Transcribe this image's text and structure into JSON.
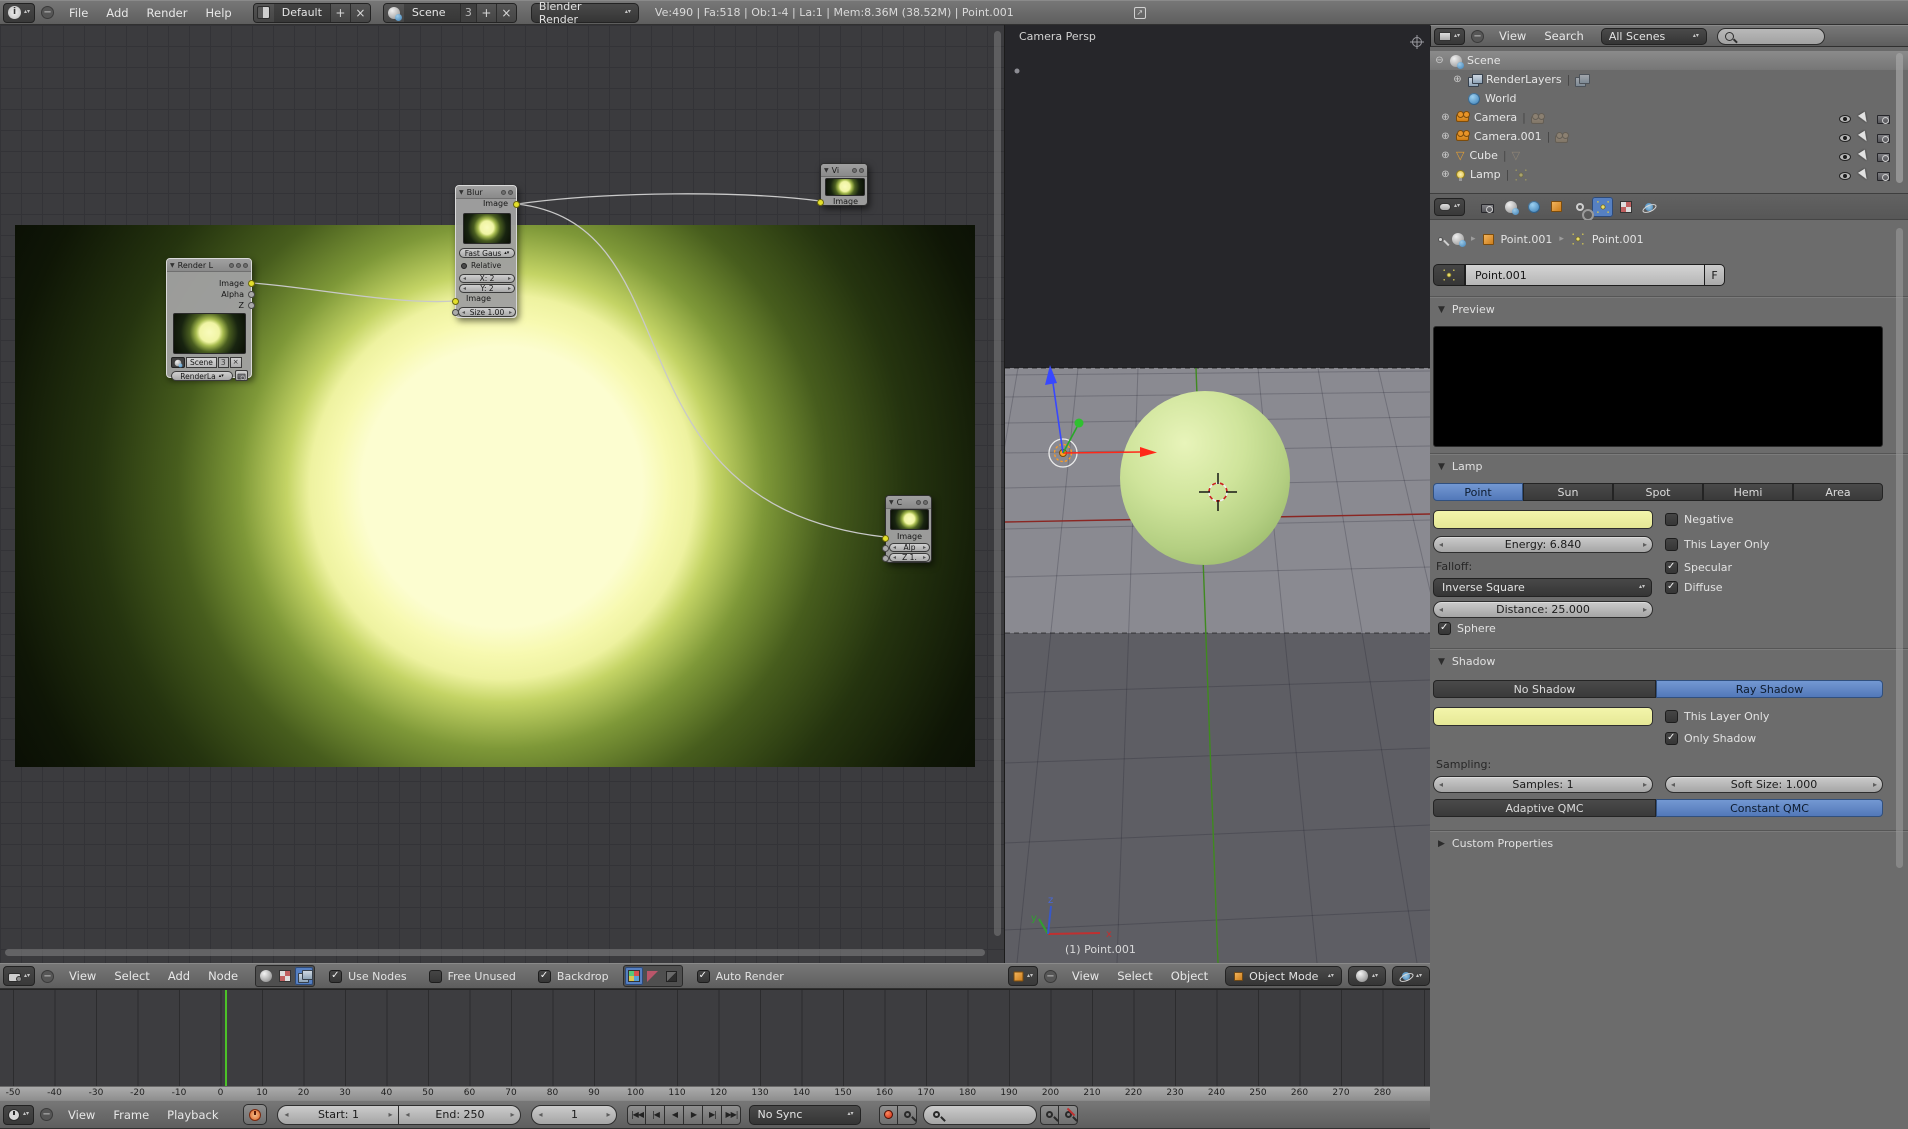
{
  "colors": {
    "accent": "#5680c2",
    "lamp_yellow": "#eef0a0",
    "socket_yellow": "#e3df2b",
    "sphere_green": "#cfe49b",
    "current_frame_green": "#4cc228"
  },
  "top_header": {
    "menus": [
      "File",
      "Add",
      "Render",
      "Help"
    ],
    "layout": "Default",
    "scene": "Scene",
    "scene_users": "3",
    "engine": "Blender Render",
    "stats": "Ve:490 | Fa:518 | Ob:1-4 | La:1 | Mem:8.36M (38.52M) | Point.001"
  },
  "node_editor": {
    "menus": [
      "View",
      "Select",
      "Add",
      "Node"
    ],
    "toggles": {
      "use_nodes": "Use Nodes",
      "free_unused": "Free Unused",
      "backdrop": "Backdrop",
      "auto_render": "Auto Render"
    },
    "nodes": {
      "render_layers": {
        "title": "Render L",
        "outputs": [
          "Image",
          "Alpha",
          "Z"
        ],
        "scene_field": "Scene",
        "scene_users": "3",
        "layer_field": "RenderLa"
      },
      "blur": {
        "title": "Blur",
        "output": "Image",
        "filter_type": "Fast Gaus",
        "relative_label": "Relative",
        "x_field": "X: 2",
        "y_field": "Y: 2",
        "input": "Image",
        "size_field": "Size 1.00"
      },
      "viewer": {
        "title": "Vi",
        "input": "Image"
      },
      "composite": {
        "title": "C",
        "input": "Image",
        "alpha_field": "Alp",
        "z_field": "Z 1."
      }
    }
  },
  "viewport": {
    "view_label": "Camera Persp",
    "object_info": "(1) Point.001",
    "menus": [
      "View",
      "Select",
      "Object"
    ],
    "mode": "Object Mode",
    "axis": {
      "x": "x",
      "y": "y",
      "z": "z"
    }
  },
  "outliner": {
    "menus": [
      "View",
      "Search"
    ],
    "filter": "All Scenes",
    "items": [
      {
        "label": "Scene"
      },
      {
        "label": "RenderLayers"
      },
      {
        "label": "World"
      },
      {
        "label": "Camera"
      },
      {
        "label": "Camera.001"
      },
      {
        "label": "Cube"
      },
      {
        "label": "Lamp"
      }
    ]
  },
  "properties": {
    "breadcrumb": {
      "object": "Point.001",
      "data": "Point.001"
    },
    "name": "Point.001",
    "fake_user": "F",
    "preview_title": "Preview",
    "lamp": {
      "title": "Lamp",
      "types": [
        "Point",
        "Sun",
        "Spot",
        "Hemi",
        "Area"
      ],
      "negative": "Negative",
      "energy": "Energy: 6.840",
      "this_layer_only": "This Layer Only",
      "falloff_label": "Falloff:",
      "falloff_value": "Inverse Square",
      "specular": "Specular",
      "diffuse": "Diffuse",
      "distance": "Distance: 25.000",
      "sphere": "Sphere"
    },
    "shadow": {
      "title": "Shadow",
      "no_shadow": "No Shadow",
      "ray_shadow": "Ray Shadow",
      "this_layer_only": "This Layer Only",
      "only_shadow": "Only Shadow",
      "sampling_label": "Sampling:",
      "samples": "Samples: 1",
      "soft_size": "Soft Size: 1.000",
      "adaptive_qmc": "Adaptive QMC",
      "constant_qmc": "Constant QMC"
    },
    "custom_properties_title": "Custom Properties"
  },
  "timeline": {
    "menus": [
      "View",
      "Frame",
      "Playback"
    ],
    "start": "Start: 1",
    "end": "End: 250",
    "current": "1",
    "sync": "No Sync",
    "ruler_ticks": [
      -50,
      -40,
      -30,
      -20,
      -10,
      0,
      10,
      20,
      30,
      40,
      50,
      60,
      70,
      80,
      90,
      100,
      110,
      120,
      130,
      140,
      150,
      160,
      170,
      180,
      190,
      200,
      210,
      220,
      230,
      240,
      250,
      260,
      270,
      280
    ]
  }
}
